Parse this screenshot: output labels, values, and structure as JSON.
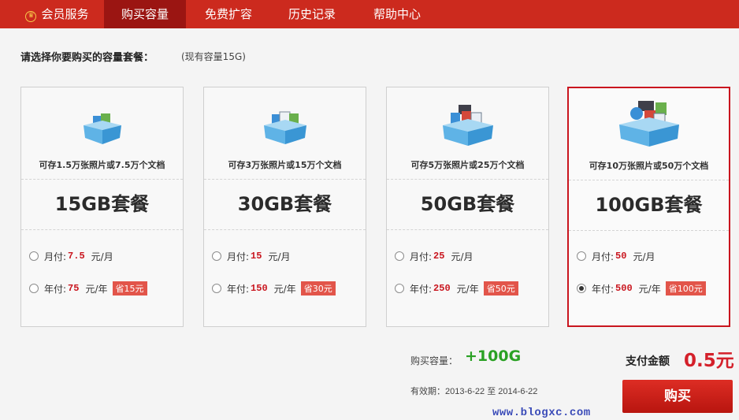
{
  "nav": {
    "items": [
      {
        "label": "会员服务"
      },
      {
        "label": "购买容量"
      },
      {
        "label": "免费扩容"
      },
      {
        "label": "历史记录"
      },
      {
        "label": "帮助中心"
      }
    ]
  },
  "prompt": "请选择你要购买的容量套餐：",
  "current_capacity": "(现有容量15G)",
  "plans": [
    {
      "desc": "可存1.5万张照片或7.5万个文档",
      "title": "15GB套餐",
      "month_label": "月付:",
      "month_price": "7.5",
      "month_unit": "元/月",
      "year_label": "年付:",
      "year_price": "75",
      "year_unit": "元/年",
      "save": "省15元"
    },
    {
      "desc": "可存3万张照片或15万个文档",
      "title": "30GB套餐",
      "month_label": "月付:",
      "month_price": "15",
      "month_unit": "元/月",
      "year_label": "年付:",
      "year_price": "150",
      "year_unit": "元/年",
      "save": "省30元"
    },
    {
      "desc": "可存5万张照片或25万个文档",
      "title": "50GB套餐",
      "month_label": "月付:",
      "month_price": "25",
      "month_unit": "元/月",
      "year_label": "年付:",
      "year_price": "250",
      "year_unit": "元/年",
      "save": "省50元"
    },
    {
      "desc": "可存10万张照片或50万个文档",
      "title": "100GB套餐",
      "month_label": "月付:",
      "month_price": "50",
      "month_unit": "元/月",
      "year_label": "年付:",
      "year_price": "500",
      "year_unit": "元/年",
      "save": "省100元"
    }
  ],
  "summary": {
    "buy_volume_label": "购买容量：",
    "buy_volume": "+100G",
    "pay_label": "支付金额",
    "pay_amount": "0.5元",
    "validity": "有效期：2013-6-22 至 2014-6-22",
    "buy_button": "购买"
  },
  "watermark": "www.blogxc.com",
  "colors": {
    "nav": "#cc2a1e",
    "nav_active": "#9b1512",
    "accent": "#c9151e",
    "green": "#2aa124"
  }
}
